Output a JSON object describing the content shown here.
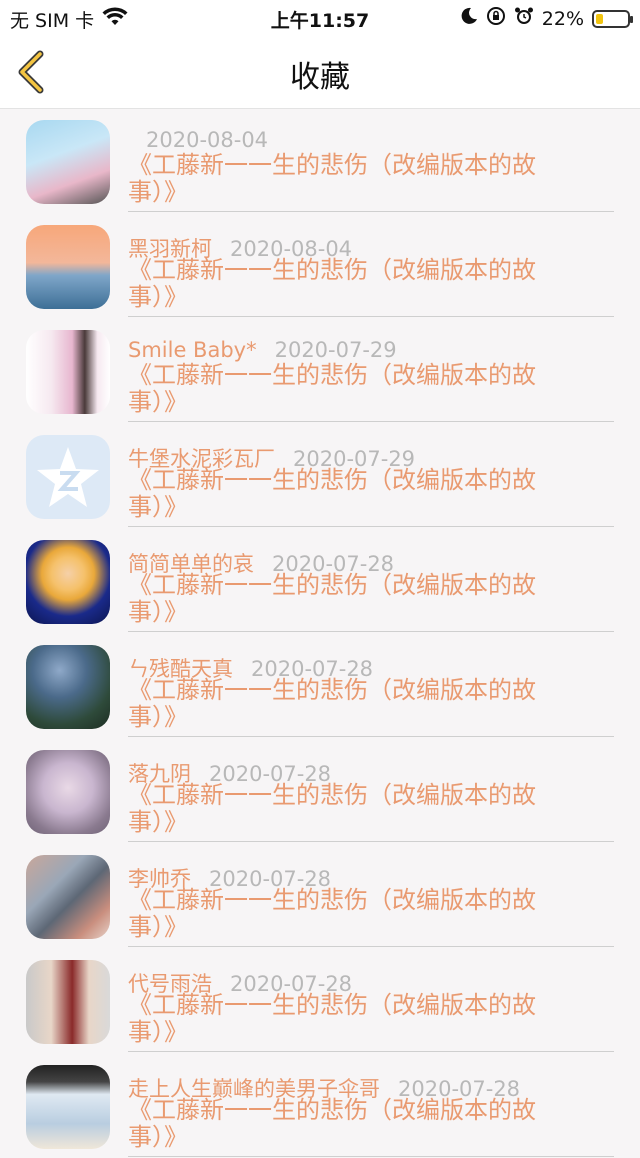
{
  "status": {
    "carrier": "无 SIM 卡",
    "time": "上午11:57",
    "battery": "22%",
    "battery_level": 0.22
  },
  "nav": {
    "title": "收藏"
  },
  "items": [
    {
      "name": "",
      "date": "2020-08-04",
      "message": "《工藤新一一生的悲伤（改编版本的故事）》"
    },
    {
      "name": "黑羽新柯",
      "date": "2020-08-04",
      "message": "《工藤新一一生的悲伤（改编版本的故事）》"
    },
    {
      "name": "Smile Baby*",
      "date": "2020-07-29",
      "message": "《工藤新一一生的悲伤（改编版本的故事）》"
    },
    {
      "name": "牛堡水泥彩瓦厂",
      "date": "2020-07-29",
      "message": "《工藤新一一生的悲伤（改编版本的故事）》"
    },
    {
      "name": "简简单单的哀",
      "date": "2020-07-28",
      "message": "《工藤新一一生的悲伤（改编版本的故事）》"
    },
    {
      "name": "ㄣ残酷天真",
      "date": "2020-07-28",
      "message": "《工藤新一一生的悲伤（改编版本的故事）》"
    },
    {
      "name": "落九阴",
      "date": "2020-07-28",
      "message": "《工藤新一一生的悲伤（改编版本的故事）》"
    },
    {
      "name": "李帅乔",
      "date": "2020-07-28",
      "message": "《工藤新一一生的悲伤（改编版本的故事）》"
    },
    {
      "name": "代号雨浩",
      "date": "2020-07-28",
      "message": "《工藤新一一生的悲伤（改编版本的故事）》"
    },
    {
      "name": "走上人生巅峰的美男子伞哥",
      "date": "2020-07-28",
      "message": "《工藤新一一生的悲伤（改编版本的故事）》"
    }
  ]
}
